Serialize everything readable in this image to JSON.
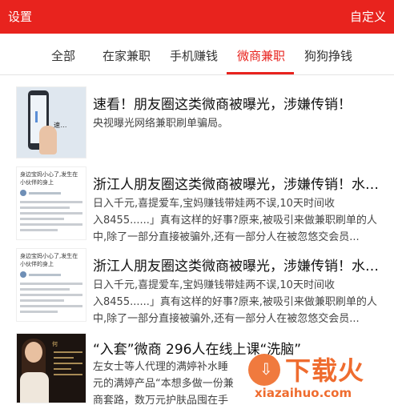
{
  "topbar": {
    "left_label": "设置",
    "right_label": "自定义"
  },
  "tabs": [
    {
      "label": "全部"
    },
    {
      "label": "在家兼职"
    },
    {
      "label": "手机赚钱"
    },
    {
      "label": "微商兼职"
    },
    {
      "label": "狗狗挣钱"
    }
  ],
  "active_tab": "微商兼职",
  "articles": [
    {
      "title": "速看！朋友圈这类微商被曝光，涉嫌传销！",
      "desc_lines": [
        "央视曝光网络兼职刷单骗局。"
      ],
      "thumb_text": "速…"
    },
    {
      "title": "浙江人朋友圈这类微商被曝光，涉嫌传销！水军大量…",
      "desc_lines": [
        "日入千元,喜提爱车,宝妈赚钱带娃两不误,10天时间收",
        "入8455......」真有这样的好事?原来,被吸引来做兼职刷单的人",
        "中,除了一部分直接被骗外,还有一部分人在被忽悠交会员..."
      ],
      "thumb_heading": "身边宝妈小心了,发生在小伙伴的身上"
    },
    {
      "title": "浙江人朋友圈这类微商被曝光，涉嫌传销！水军大量…",
      "desc_lines": [
        "日入千元,喜提爱车,宝妈赚钱带娃两不误,10天时间收",
        "入8455......」真有这样的好事?原来,被吸引来做兼职刷单的人",
        "中,除了一部分直接被骗外,还有一部分人在被忽悠交会员..."
      ],
      "thumb_heading": "身边宝妈小心了,发生在小伙伴的身上"
    },
    {
      "title": "“入套”微商 296人在线上课“洗脑”",
      "desc_lines": [
        "左女士等人代理的满婷补水睡",
        "元的满婷产品“本想多做一份兼",
        "商套路，数万元护肤品囤在手"
      ],
      "thumb_tag": "何"
    }
  ],
  "watermark": {
    "title": "下载火",
    "subtitle": "xiazaihuo.com"
  },
  "colors": {
    "brand_red": "#e8231e",
    "watermark_orange": "#ef6c2f"
  }
}
